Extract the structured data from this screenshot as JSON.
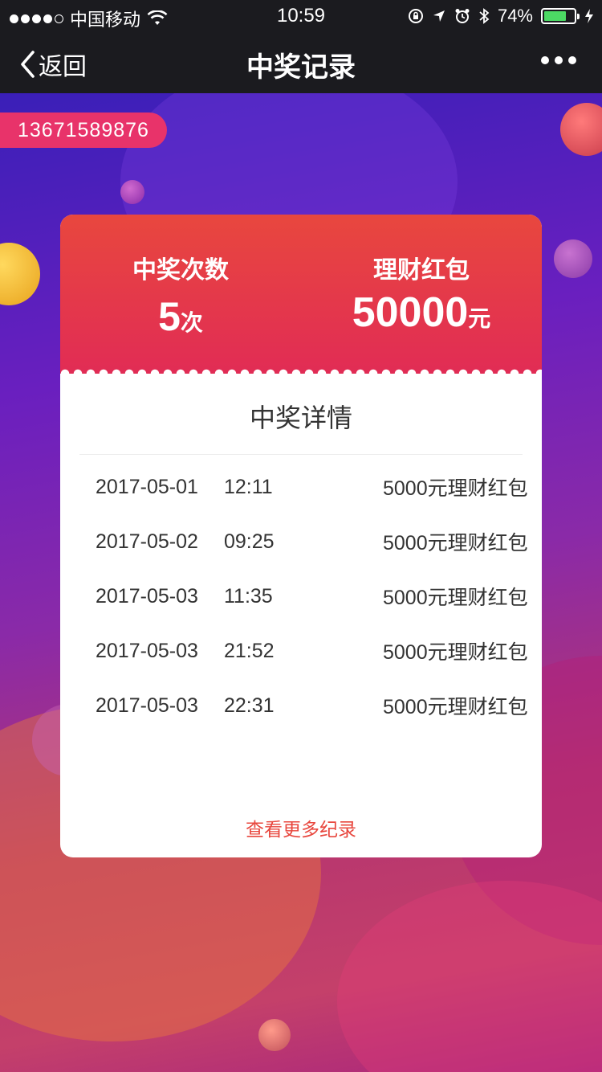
{
  "status": {
    "carrier": "中国移动",
    "time": "10:59",
    "battery": "74%",
    "battery_level": 0.74
  },
  "nav": {
    "back_label": "返回",
    "title": "中奖记录"
  },
  "user": {
    "phone": "13671589876"
  },
  "summary": {
    "count_label": "中奖次数",
    "count_value": "5",
    "count_unit": "次",
    "amount_label": "理财红包",
    "amount_value": "50000",
    "amount_unit": "元"
  },
  "details": {
    "title": "中奖详情",
    "rows": [
      {
        "date": "2017-05-01",
        "time": "12:11",
        "prize": "5000元理财红包"
      },
      {
        "date": "2017-05-02",
        "time": "09:25",
        "prize": "5000元理财红包"
      },
      {
        "date": "2017-05-03",
        "time": "11:35",
        "prize": "5000元理财红包"
      },
      {
        "date": "2017-05-03",
        "time": "21:52",
        "prize": "5000元理财红包"
      },
      {
        "date": "2017-05-03",
        "time": "22:31",
        "prize": "5000元理财红包"
      }
    ],
    "more_label": "查看更多纪录"
  },
  "colors": {
    "accent": "#e8473e",
    "tag": "#e8336a",
    "navbar": "#1b1b1f"
  }
}
